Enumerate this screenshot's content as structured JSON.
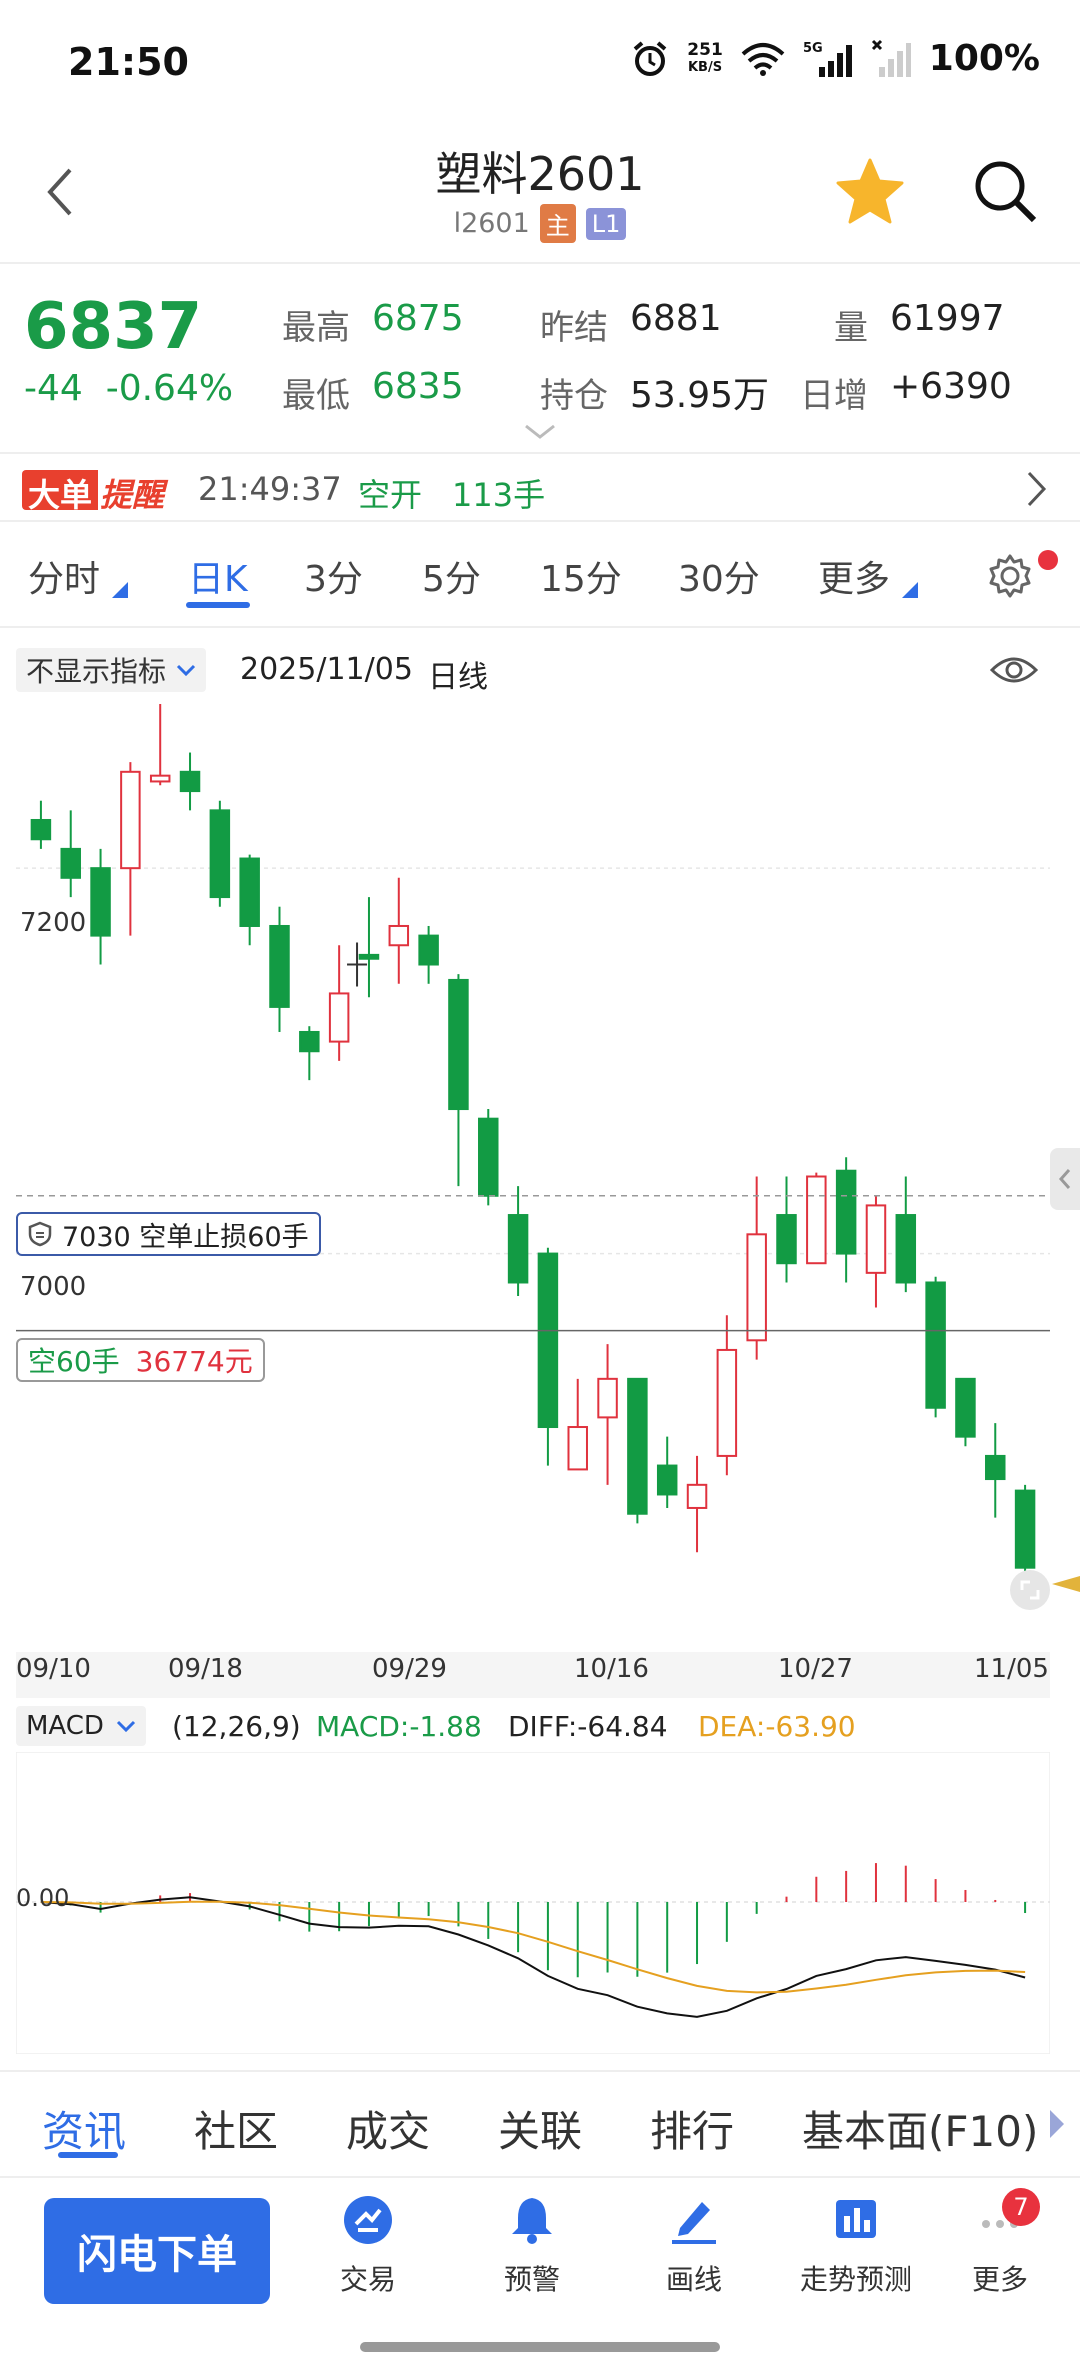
{
  "status": {
    "time": "21:50",
    "net_speed_top": "251",
    "net_speed_bottom": "KB/S",
    "network": "5G",
    "battery": "100%"
  },
  "header": {
    "title": "塑料2601",
    "code": "l2601",
    "badge_main": "主",
    "badge_level": "L1"
  },
  "quote": {
    "price": "6837",
    "change": "-44",
    "change_pct": "-0.64%",
    "high_label": "最高",
    "high": "6875",
    "low_label": "最低",
    "low": "6835",
    "prev_settle_label": "昨结",
    "prev_settle": "6881",
    "open_interest_label": "持仓",
    "open_interest": "53.95万",
    "volume_label": "量",
    "volume": "61997",
    "daily_increase_label": "日增",
    "daily_increase": "+6390"
  },
  "alert": {
    "logo_a": "大单",
    "logo_b": "提醒",
    "time": "21:49:37",
    "action": "空开",
    "amount": "113手"
  },
  "periods": {
    "tabs": [
      "分时",
      "日K",
      "3分",
      "5分",
      "15分",
      "30分",
      "更多"
    ],
    "active": "日K"
  },
  "chart_header": {
    "indicator_select": "不显示指标",
    "date": "2025/11/05",
    "type": "日线"
  },
  "chart_labels": {
    "price_7200": "7200",
    "price_7000": "7000",
    "stop_loss": "7030  空单止损60手",
    "position_side": "空60手",
    "position_value": "36774元",
    "macd_zero": "0.00"
  },
  "chart_data": {
    "type": "candlestick",
    "ylim": [
      6800,
      7280
    ],
    "x_ticks": [
      "09/10",
      "09/18",
      "09/29",
      "10/16",
      "10/27",
      "11/05"
    ],
    "grid": true,
    "reference_lines": [
      {
        "label": "7030",
        "value": 7030
      },
      {
        "label": "position",
        "value": 6960
      }
    ],
    "candles": [
      {
        "o": 7225,
        "c": 7215,
        "h": 7235,
        "l": 7210
      },
      {
        "o": 7210,
        "c": 7195,
        "h": 7230,
        "l": 7185
      },
      {
        "o": 7200,
        "c": 7165,
        "h": 7210,
        "l": 7150
      },
      {
        "o": 7200,
        "c": 7250,
        "h": 7255,
        "l": 7165
      },
      {
        "o": 7245,
        "c": 7248,
        "h": 7300,
        "l": 7243
      },
      {
        "o": 7250,
        "c": 7240,
        "h": 7260,
        "l": 7230
      },
      {
        "o": 7230,
        "c": 7185,
        "h": 7235,
        "l": 7180
      },
      {
        "o": 7205,
        "c": 7170,
        "h": 7207,
        "l": 7160
      },
      {
        "o": 7170,
        "c": 7128,
        "h": 7180,
        "l": 7115
      },
      {
        "o": 7115,
        "c": 7105,
        "h": 7118,
        "l": 7090
      },
      {
        "o": 7110,
        "c": 7135,
        "h": 7160,
        "l": 7100
      },
      {
        "o": 7155,
        "c": 7153,
        "h": 7185,
        "l": 7133
      },
      {
        "o": 7160,
        "c": 7170,
        "h": 7195,
        "l": 7140
      },
      {
        "o": 7165,
        "c": 7150,
        "h": 7170,
        "l": 7140
      },
      {
        "o": 7142,
        "c": 7075,
        "h": 7145,
        "l": 7035
      },
      {
        "o": 7070,
        "c": 7030,
        "h": 7075,
        "l": 7025
      },
      {
        "o": 7020,
        "c": 6985,
        "h": 7035,
        "l": 6978
      },
      {
        "o": 7000,
        "c": 6910,
        "h": 7003,
        "l": 6890
      },
      {
        "o": 6888,
        "c": 6910,
        "h": 6935,
        "l": 6888
      },
      {
        "o": 6915,
        "c": 6935,
        "h": 6953,
        "l": 6880
      },
      {
        "o": 6935,
        "c": 6865,
        "h": 6935,
        "l": 6860
      },
      {
        "o": 6890,
        "c": 6875,
        "h": 6905,
        "l": 6868
      },
      {
        "o": 6868,
        "c": 6880,
        "h": 6895,
        "l": 6845
      },
      {
        "o": 6895,
        "c": 6950,
        "h": 6968,
        "l": 6885
      },
      {
        "o": 6955,
        "c": 7010,
        "h": 7040,
        "l": 6945
      },
      {
        "o": 7020,
        "c": 6995,
        "h": 7040,
        "l": 6985
      },
      {
        "o": 6995,
        "c": 7040,
        "h": 7042,
        "l": 6995
      },
      {
        "o": 7043,
        "c": 7000,
        "h": 7050,
        "l": 6985
      },
      {
        "o": 6990,
        "c": 7025,
        "h": 7030,
        "l": 6972
      },
      {
        "o": 7020,
        "c": 6985,
        "h": 7040,
        "l": 6980
      },
      {
        "o": 6985,
        "c": 6920,
        "h": 6988,
        "l": 6915
      },
      {
        "o": 6935,
        "c": 6905,
        "h": 6935,
        "l": 6900
      },
      {
        "o": 6895,
        "c": 6883,
        "h": 6912,
        "l": 6863
      },
      {
        "o": 6877,
        "c": 6837,
        "h": 6880,
        "l": 6835
      }
    ],
    "macd": {
      "params": "(12,26,9)",
      "macd_label": "MACD:-1.88",
      "diff_label": "DIFF:-64.84",
      "dea_label": "DEA:-63.90",
      "macd_select": "MACD"
    }
  },
  "bottom_tabs": [
    "资讯",
    "社区",
    "成交",
    "关联",
    "排行",
    "基本面(F10)"
  ],
  "toolbar": {
    "order_button": "闪电下单",
    "items": [
      "交易",
      "预警",
      "画线",
      "走势预测",
      "更多"
    ],
    "more_badge": "7"
  },
  "colors": {
    "up": "#e0323e",
    "down": "#129b44",
    "accent": "#2f6de5",
    "macd_diff": "#111111",
    "macd_dea": "#e5a020"
  }
}
